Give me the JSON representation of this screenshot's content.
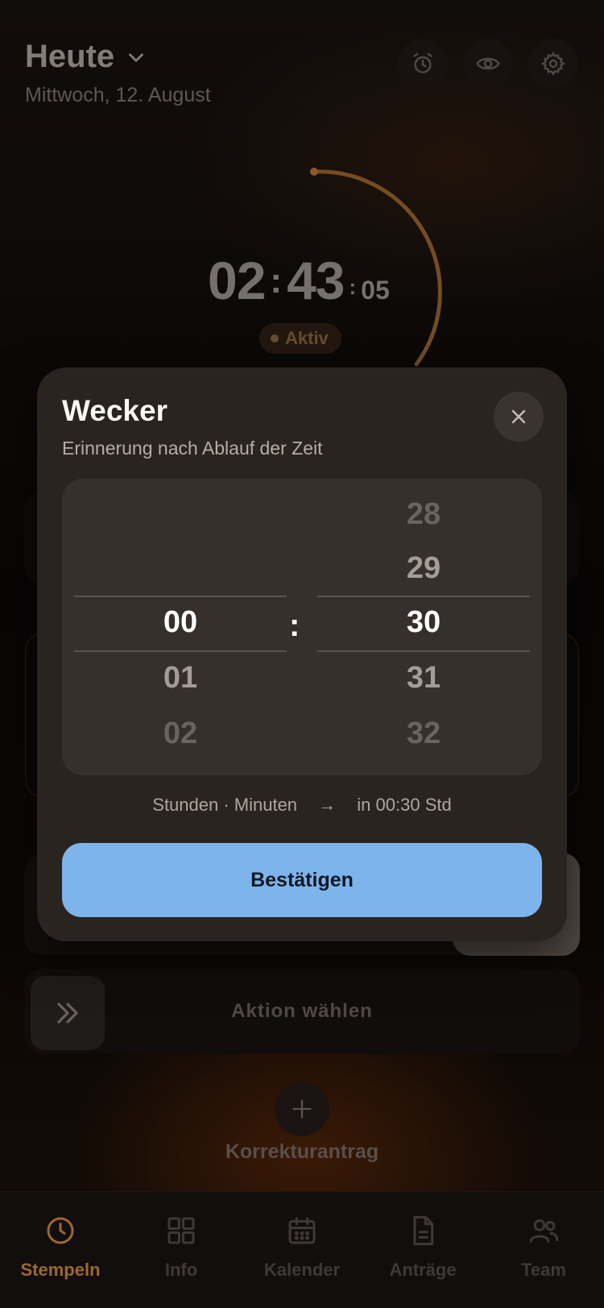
{
  "header": {
    "title": "Heute",
    "date": "Mittwoch, 12. August"
  },
  "timer": {
    "hours": "02",
    "minutes": "43",
    "seconds": "05",
    "status": "Aktiv"
  },
  "action": {
    "label": "Aktion wählen"
  },
  "correction": {
    "label": "Korrekturantrag"
  },
  "nav": {
    "items": [
      {
        "label": "Stempeln",
        "icon": "clock-icon",
        "active": true
      },
      {
        "label": "Info",
        "icon": "grid-icon"
      },
      {
        "label": "Kalender",
        "icon": "calendar-icon"
      },
      {
        "label": "Anträge",
        "icon": "document-icon"
      },
      {
        "label": "Team",
        "icon": "team-icon"
      }
    ]
  },
  "modal": {
    "title": "Wecker",
    "subtitle": "Erinnerung nach Ablauf der Zeit",
    "hours": {
      "values": [
        "00",
        "01",
        "02"
      ],
      "selected": "00"
    },
    "minutes": {
      "values": [
        "28",
        "29",
        "30",
        "31",
        "32"
      ],
      "selected": "30"
    },
    "separator": ":",
    "summary_units": "Stunden · Minuten",
    "summary_arrow": "→",
    "summary_result": "in 00:30 Std",
    "confirm_label": "Bestätigen"
  },
  "colors": {
    "accent": "#b97a3a",
    "confirm": "#7db4ec",
    "modal_bg": "#2a2421"
  }
}
